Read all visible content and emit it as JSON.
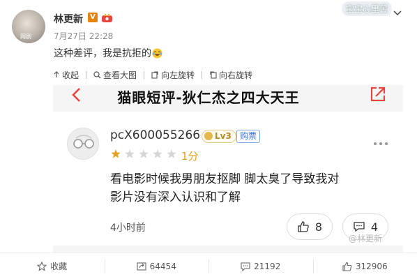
{
  "post": {
    "author": "林更新",
    "avatar_watermark": "网剧",
    "verified_badge": "V",
    "time": "7月27日 22:28",
    "text": "这种差评，我是抗拒的",
    "emoji": "laugh-cry-emoji",
    "top_watermark": "宝宝心里苦"
  },
  "image_toolbar": {
    "collapse": "收起",
    "view_large": "查看大图",
    "rotate_left": "向左旋转",
    "rotate_right": "向右旋转"
  },
  "screenshot": {
    "title": "猫眼短评-狄仁杰之四大天王",
    "review": {
      "username": "pcX600055266",
      "level": "Lv3",
      "buy_tag": "购票",
      "stars_filled": 1,
      "stars_total": 5,
      "score": "1分",
      "text": "看电影时候我男朋友抠脚 脚太臭了导致我对影片没有深入认识和了解",
      "time": "4小时前",
      "likes": "8",
      "comments": "4"
    },
    "bottom_watermark": "@林更新"
  },
  "actions": {
    "favorite": "收藏",
    "reposts": "64454",
    "comments": "21192",
    "likes": "312906"
  },
  "colors": {
    "accent_orange": "#e6820e",
    "star_gold": "#e6a020",
    "share_red": "#e5473e"
  }
}
